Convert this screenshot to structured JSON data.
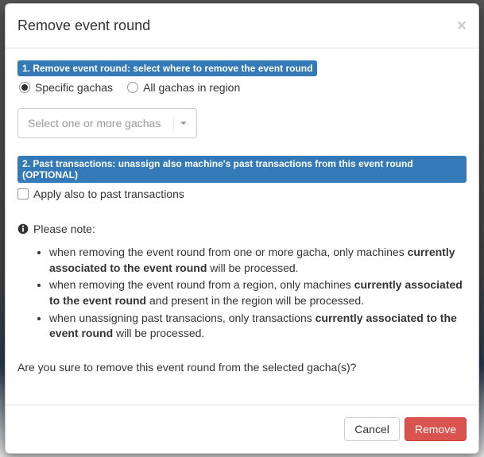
{
  "modal": {
    "title": "Remove event round",
    "close_glyph": "×"
  },
  "section1": {
    "header": "1. Remove event round: select where to remove the event round",
    "radio_specific": "Specific gachas",
    "radio_region": "All gachas in region"
  },
  "dropdown": {
    "placeholder": "Select one or more gachas"
  },
  "section2": {
    "header": "2. Past transactions: unassign also machine's past transactions from this event round (OPTIONAL)",
    "checkbox_label": "Apply also to past transactions"
  },
  "note": {
    "label": "Please note:",
    "items": [
      {
        "pre": "when removing the event round from one or more gacha, only machines ",
        "bold": "currently associated to the event round",
        "post": " will be processed."
      },
      {
        "pre": "when removing the event round from a region, only machines ",
        "bold": "currently associated to the event round",
        "post": " and present in the region will be processed."
      },
      {
        "pre": "when unassigning past transacions, only transactions ",
        "bold": "currently associated to the event round",
        "post": " will be processed."
      }
    ]
  },
  "confirm_text": "Are you sure to remove this event round from the selected gacha(s)?",
  "footer": {
    "cancel": "Cancel",
    "remove": "Remove"
  }
}
